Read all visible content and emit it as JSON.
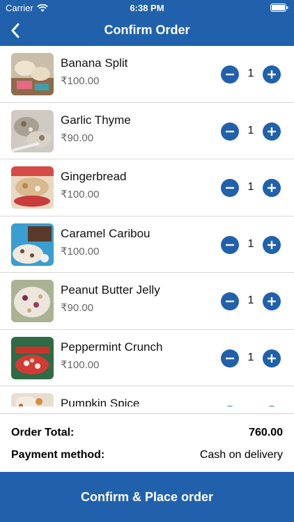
{
  "status_bar": {
    "carrier": "Carrier",
    "time": "6:38 PM"
  },
  "nav": {
    "title": "Confirm Order",
    "back_icon": "chevron-left-icon"
  },
  "accent_color": "#2161ac",
  "items": [
    {
      "name": "Banana Split",
      "price": "₹100.00",
      "qty": "1"
    },
    {
      "name": "Garlic Thyme",
      "price": "₹90.00",
      "qty": "1"
    },
    {
      "name": "Gingerbread",
      "price": "₹100.00",
      "qty": "1"
    },
    {
      "name": "Caramel Caribou",
      "price": "₹100.00",
      "qty": "1"
    },
    {
      "name": "Peanut Butter Jelly",
      "price": "₹90.00",
      "qty": "1"
    },
    {
      "name": "Peppermint Crunch",
      "price": "₹100.00",
      "qty": "1"
    },
    {
      "name": "Pumpkin Spice",
      "price": "",
      "qty": ""
    }
  ],
  "summary": {
    "total_label": "Order Total:",
    "total_value": "760.00",
    "payment_label": "Payment method:",
    "payment_value": "Cash on delivery"
  },
  "confirm_button": "Confirm & Place order"
}
